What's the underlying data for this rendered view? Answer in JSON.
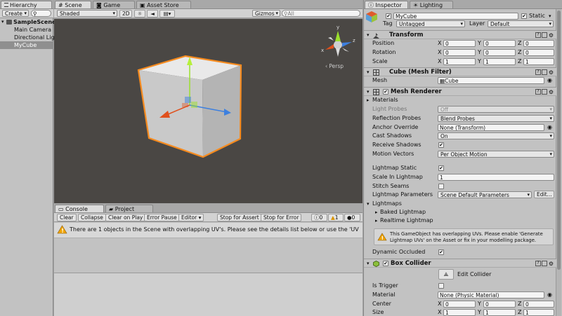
{
  "hierarchy": {
    "tab": "Hierarchy",
    "create_label": "Create",
    "scene_name": "SampleScene",
    "items": [
      "Main Camera",
      "Directional Light",
      "MyCube"
    ]
  },
  "scene": {
    "tabs": [
      "Scene",
      "Game",
      "Asset Store"
    ],
    "shading": "Shaded",
    "mode_2d": "2D",
    "gizmos": "Gizmos",
    "search_placeholder": "All",
    "persp_label": "Persp",
    "gizmo_axes": {
      "x": "x",
      "y": "y",
      "z": "z"
    }
  },
  "console": {
    "tabs": [
      "Console",
      "Project"
    ],
    "buttons": [
      "Clear",
      "Collapse",
      "Clear on Play",
      "Error Pause",
      "Editor"
    ],
    "stop_assert": "Stop for Assert",
    "stop_error": "Stop for Error",
    "counts": {
      "info": "0",
      "warn": "1",
      "error": "0"
    },
    "message": "There are 1 objects in the Scene with overlapping UV's. Please see the details list below or use the 'UV"
  },
  "inspector": {
    "tabs": [
      "Inspector",
      "Lighting"
    ],
    "object_name": "MyCube",
    "static_label": "Static",
    "tag_label": "Tag",
    "tag_value": "Untagged",
    "layer_label": "Layer",
    "layer_value": "Default",
    "transform": {
      "title": "Transform",
      "rows": [
        {
          "label": "Position",
          "x": "0",
          "y": "0",
          "z": "0"
        },
        {
          "label": "Rotation",
          "x": "0",
          "y": "0",
          "z": "0"
        },
        {
          "label": "Scale",
          "x": "1",
          "y": "1",
          "z": "1"
        }
      ]
    },
    "mesh_filter": {
      "title": "Cube (Mesh Filter)",
      "mesh_label": "Mesh",
      "mesh_value": "Cube"
    },
    "mesh_renderer": {
      "title": "Mesh Renderer",
      "materials": "Materials",
      "light_probes": "Light Probes",
      "light_probes_value": "Off",
      "reflection_probes": "Reflection Probes",
      "reflection_probes_value": "Blend Probes",
      "anchor_override": "Anchor Override",
      "anchor_override_value": "None (Transform)",
      "cast_shadows": "Cast Shadows",
      "cast_shadows_value": "On",
      "receive_shadows": "Receive Shadows",
      "motion_vectors": "Motion Vectors",
      "motion_vectors_value": "Per Object Motion",
      "lightmap_static": "Lightmap Static",
      "scale_in_lightmap": "Scale In Lightmap",
      "scale_in_lightmap_value": "1",
      "stitch_seams": "Stitch Seams",
      "lightmap_parameters": "Lightmap Parameters",
      "lightmap_parameters_value": "Scene Default Parameters",
      "edit_btn": "Edit...",
      "lightmaps": "Lightmaps",
      "baked_lightmap": "Baked Lightmap",
      "realtime_lightmap": "Realtime Lightmap",
      "warning_line1": "This GameObject has overlapping UVs. Please enable 'Generate",
      "warning_line2": "Lightmap UVs' on the Asset or fix in your modelling package.",
      "dynamic_occluded": "Dynamic Occluded"
    },
    "box_collider": {
      "title": "Box Collider",
      "edit_collider": "Edit Collider",
      "is_trigger": "Is Trigger",
      "material": "Material",
      "material_value": "None (Physic Material)",
      "center": {
        "label": "Center",
        "x": "0",
        "y": "0",
        "z": "0"
      },
      "size": {
        "label": "Size",
        "x": "1",
        "y": "1",
        "z": "1"
      }
    }
  },
  "colors": {
    "selection": "#3d80df",
    "cube_outline": "#f68b1f",
    "scene_bg": "#4a4744"
  }
}
